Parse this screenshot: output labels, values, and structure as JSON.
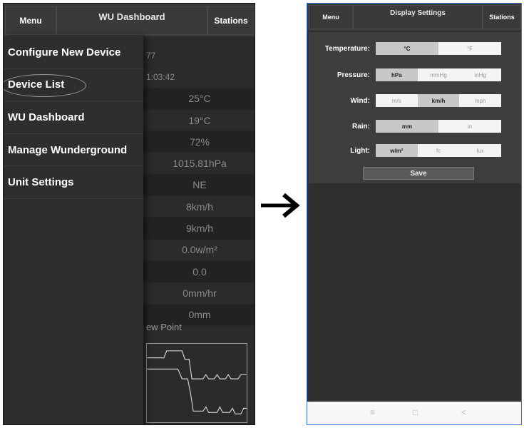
{
  "left": {
    "topbar": {
      "menu": "Menu",
      "title": "WU Dashboard",
      "stations": "Stations"
    },
    "drawer": [
      "Configure New Device",
      "Device List",
      "WU Dashboard",
      "Manage Wunderground",
      "Unit Settings"
    ],
    "dashboard_rows": [
      "77",
      "1:03:42",
      "25°C",
      "19°C",
      "72%",
      "1015.81hPa",
      "NE",
      "8km/h",
      "9km/h",
      "0.0w/m²",
      "0.0",
      "0mm/hr",
      "0mm"
    ],
    "graph_label": "ew Point"
  },
  "right": {
    "topbar": {
      "menu": "Menu",
      "title": "Display Settings",
      "stations": "Stations"
    },
    "settings": [
      {
        "label": "Temperature:",
        "options": [
          "°C",
          "°F"
        ],
        "selected": 0
      },
      {
        "label": "Pressure:",
        "options": [
          "hPa",
          "mmHg",
          "inHg"
        ],
        "selected": 0
      },
      {
        "label": "Wind:",
        "options": [
          "m/s",
          "km/h",
          "mph"
        ],
        "selected": 1
      },
      {
        "label": "Rain:",
        "options": [
          "mm",
          "in"
        ],
        "selected": 0
      },
      {
        "label": "Light:",
        "options": [
          "w/m²",
          "fc",
          "lux"
        ],
        "selected": 0
      }
    ],
    "save": "Save",
    "nav": {
      "menu_icon": "≡",
      "home_icon": "□",
      "back_icon": "<"
    }
  }
}
